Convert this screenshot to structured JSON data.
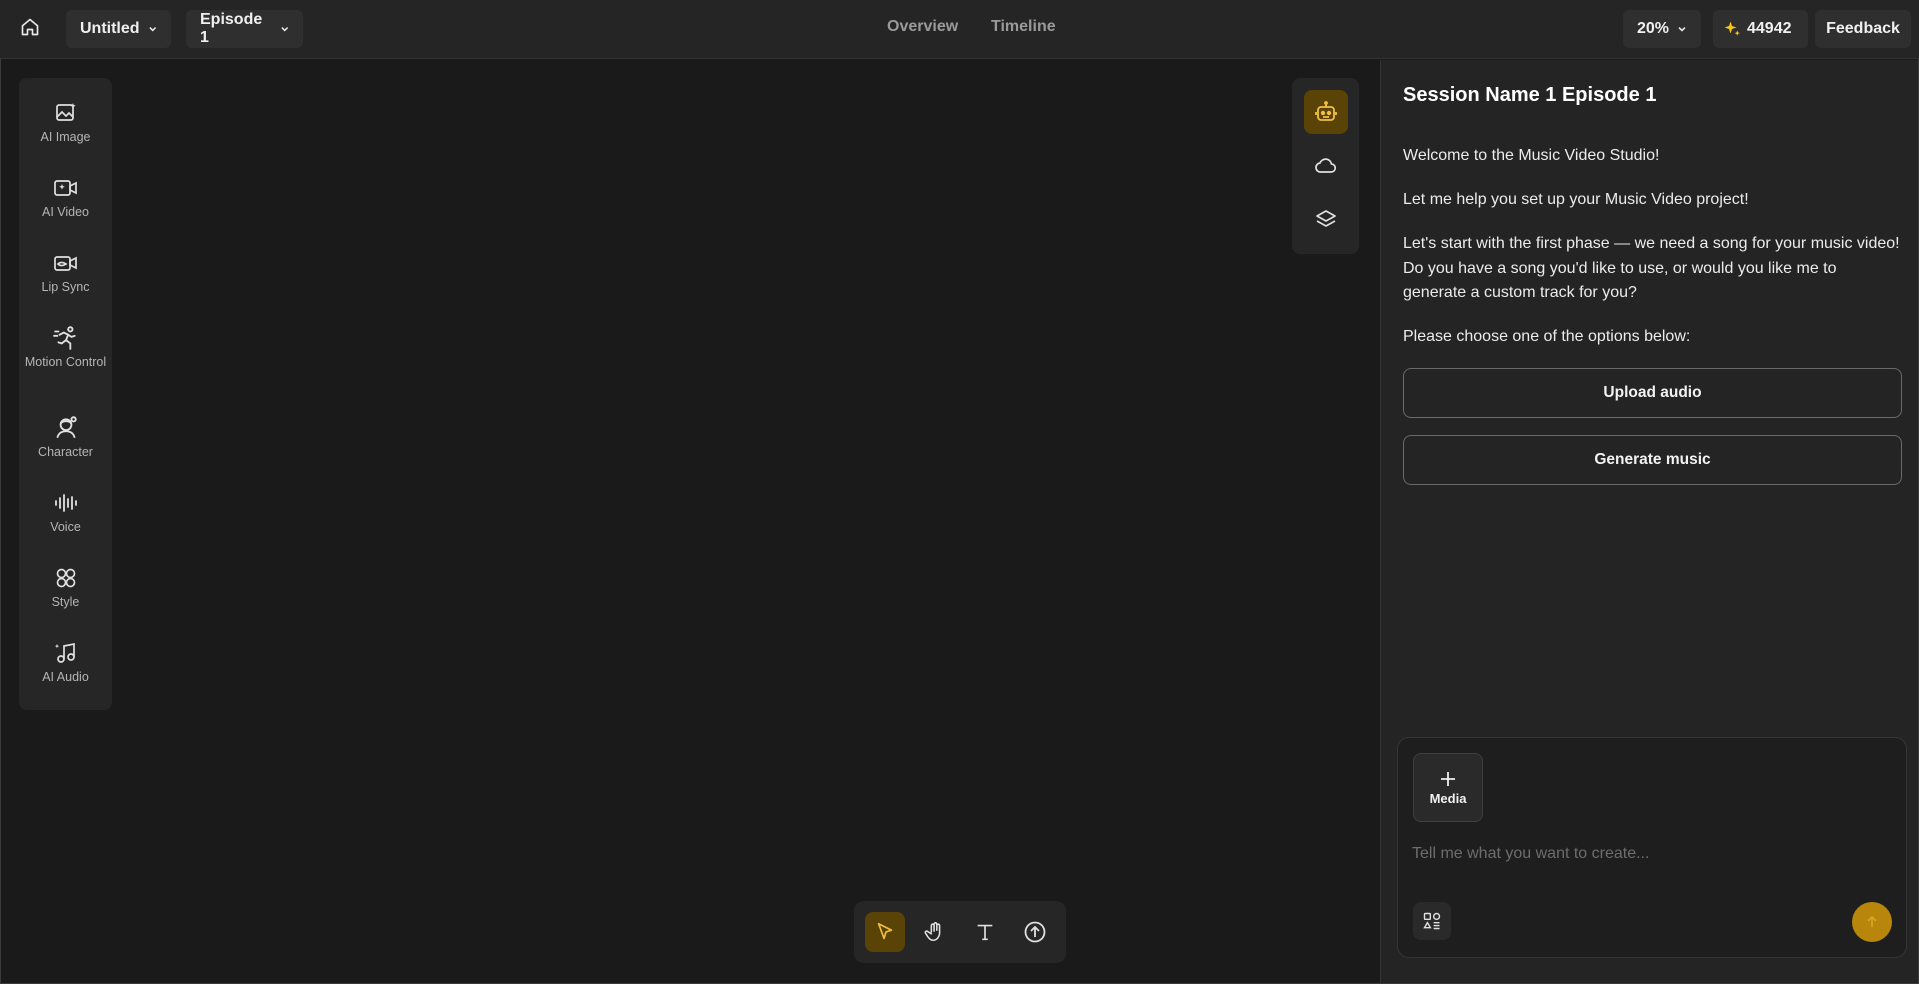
{
  "topbar": {
    "project_name": "Untitled",
    "episode": "Episode 1",
    "tabs": [
      "Overview",
      "Timeline"
    ],
    "zoom": "20%",
    "credits": "44942",
    "feedback_label": "Feedback"
  },
  "sidebar": {
    "tools": [
      {
        "label": "AI Image",
        "icon": "image-sparkle-icon"
      },
      {
        "label": "AI Video",
        "icon": "video-sparkle-icon"
      },
      {
        "label": "Lip Sync",
        "icon": "lip-sync-icon"
      },
      {
        "label": "Motion Control",
        "icon": "running-figure-icon"
      },
      {
        "label": "Character",
        "icon": "character-icon"
      },
      {
        "label": "Voice",
        "icon": "waveform-icon"
      },
      {
        "label": "Style",
        "icon": "style-icon"
      },
      {
        "label": "AI Audio",
        "icon": "music-note-icon"
      }
    ]
  },
  "canvas_tools": [
    "robot-icon",
    "cloud-icon",
    "layers-icon"
  ],
  "bottom_tools": [
    "pointer-icon",
    "hand-icon",
    "text-icon",
    "upload-icon"
  ],
  "chat": {
    "title": "Session Name 1 Episode 1",
    "messages": [
      "Welcome to the Music Video Studio!",
      "Let me help you set up your Music Video project!",
      "Let's start with the first phase — we need a song for your music video! Do you have a song you'd like to use, or would you like me to generate a custom track for you?",
      "Please choose one of the options below:"
    ],
    "options": [
      "Upload audio",
      "Generate music"
    ],
    "media_label": "Media",
    "input_placeholder": "Tell me what you want to create..."
  },
  "colors": {
    "accent": "#b8860b",
    "active_bg": "#5a4306",
    "panel_bg": "#242424",
    "canvas_bg": "#1a1a1a"
  }
}
